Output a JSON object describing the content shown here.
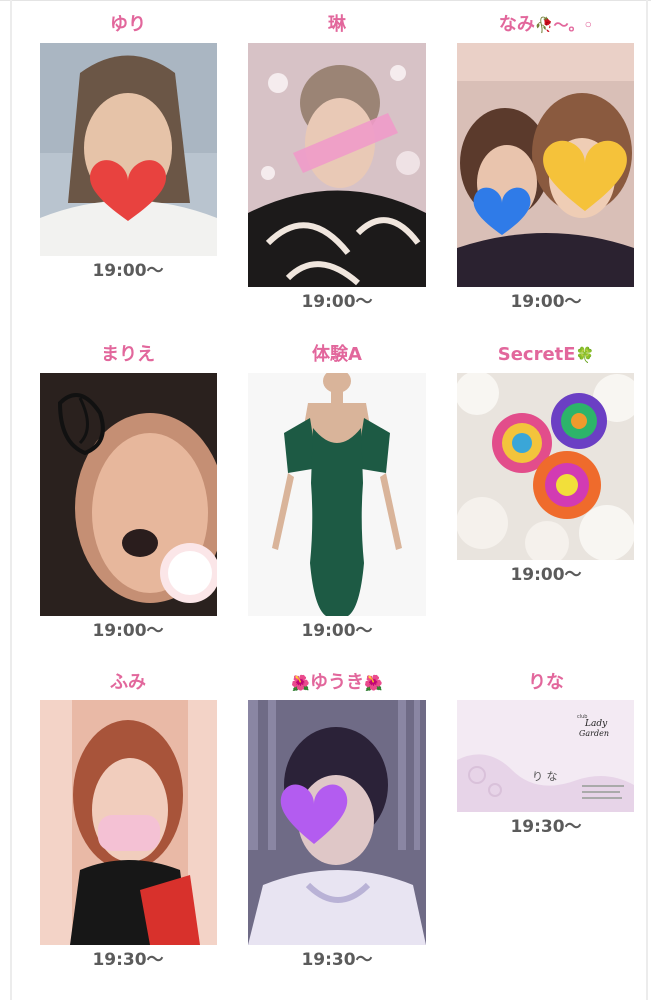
{
  "cast": [
    {
      "name": "ゆり",
      "deco_before": "",
      "deco_after": "",
      "time": "19:00〜",
      "photo": "selfie-photo-heart-sticker"
    },
    {
      "name": "琳",
      "deco_before": "",
      "deco_after": "",
      "time": "19:00〜",
      "photo": "selfie-photo-kimono"
    },
    {
      "name": "なみ",
      "deco_before": "",
      "deco_after": "🥀〜。◦",
      "time": "19:00〜",
      "photo": "selfie-photo-two-girls"
    },
    {
      "name": "まりえ",
      "deco_before": "",
      "deco_after": "",
      "time": "19:00〜",
      "photo": "selfie-photo-filter"
    },
    {
      "name": "体験A",
      "deco_before": "",
      "deco_after": "",
      "time": "19:00〜",
      "photo": "green-dress-photo"
    },
    {
      "name": "SecretE",
      "deco_before": "",
      "deco_after": "🍀",
      "time": "19:00〜",
      "photo": "rainbow-roses-photo"
    },
    {
      "name": "ふみ",
      "deco_before": "",
      "deco_after": "",
      "time": "19:30〜",
      "photo": "selfie-photo-mask"
    },
    {
      "name": "ゆうき",
      "deco_before": "🌺",
      "deco_after": "🌺",
      "time": "19:30〜",
      "photo": "selfie-photo-purple-heart"
    },
    {
      "name": "りな",
      "deco_before": "",
      "deco_after": "",
      "time": "19:30〜",
      "photo": "business-card-photo"
    }
  ],
  "card": {
    "brand_small": "club",
    "brand_line1": "Lady",
    "brand_line2": "Garden",
    "card_name": "り な"
  },
  "colors": {
    "name_pink": "#e2679c",
    "time_gray": "#5b5b5b",
    "sticker_red": "#e8423f",
    "sticker_yellow": "#f5c23a",
    "sticker_blue": "#2f7be8",
    "sticker_purple": "#b35cf0"
  }
}
